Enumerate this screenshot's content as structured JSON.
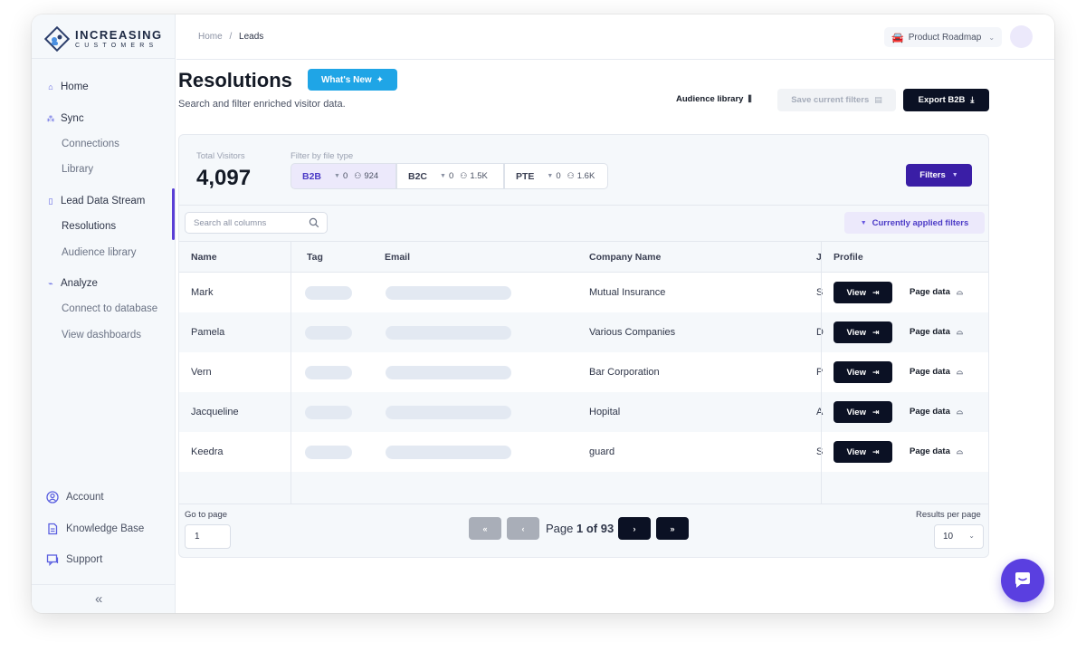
{
  "brand": {
    "name": "INCREASING",
    "tagline": "CUSTOMERS"
  },
  "sidebar": {
    "items": [
      {
        "label": "Home",
        "icon": "home-icon"
      },
      {
        "label": "Sync",
        "icon": "sync-icon"
      },
      {
        "label": "Connections"
      },
      {
        "label": "Library"
      },
      {
        "label": "Lead Data Stream",
        "icon": "document-icon"
      },
      {
        "label": "Resolutions",
        "active": true
      },
      {
        "label": "Audience library"
      },
      {
        "label": "Analyze",
        "icon": "analyze-icon"
      },
      {
        "label": "Connect to database"
      },
      {
        "label": "View dashboards"
      }
    ],
    "bottom": [
      {
        "label": "Account",
        "icon": "user-circle-icon"
      },
      {
        "label": "Knowledge Base",
        "icon": "book-icon"
      },
      {
        "label": "Support",
        "icon": "chat-bubble-icon"
      }
    ],
    "collapse_label": "«"
  },
  "header": {
    "breadcrumb": [
      "Home",
      "Leads"
    ],
    "breadcrumb_sep": "/",
    "project": "Product Roadmap"
  },
  "main": {
    "title": "Resolutions",
    "whats_new": "What's New",
    "subtitle": "Search and filter enriched visitor data.",
    "audience_library": "Audience library",
    "save_filters": "Save current filters",
    "export": "Export B2B"
  },
  "stats": {
    "total_label": "Total Visitors",
    "total_value": "4,097",
    "filter_label": "Filter by file type",
    "file_types": [
      {
        "name": "B2B",
        "filtered": "0",
        "count": "924",
        "selected": true
      },
      {
        "name": "B2C",
        "filtered": "0",
        "count": "1.5K"
      },
      {
        "name": "PTE",
        "filtered": "0",
        "count": "1.6K"
      }
    ],
    "filters_button": "Filters"
  },
  "table": {
    "search_placeholder": "Search all columns",
    "applied_filters": "Currently applied filters",
    "columns": [
      "Name",
      "Tag",
      "Email",
      "Company Name",
      "J",
      "Profile"
    ],
    "rows": [
      {
        "name": "Mark",
        "company": "Mutual Insurance",
        "j": "S"
      },
      {
        "name": "Pamela",
        "company": "Various Companies",
        "j": "D"
      },
      {
        "name": "Vern",
        "company": "Bar Corporation",
        "j": "P"
      },
      {
        "name": "Jacqueline",
        "company": "Hopital",
        "j": "A"
      },
      {
        "name": "Keedra",
        "company": "guard",
        "j": "S"
      }
    ],
    "view_label": "View",
    "page_data_label": "Page data"
  },
  "pagination": {
    "goto_label": "Go to page",
    "goto_value": "1",
    "page_prefix": "Page",
    "page_current": "1",
    "page_of": "of",
    "page_total": "93",
    "first": "«",
    "prev": "‹",
    "next": "›",
    "last": "»",
    "rpp_label": "Results per page",
    "rpp_value": "10"
  },
  "colors": {
    "accent": "#3a1ea6",
    "primary_dark": "#0b1124",
    "whats_new": "#1fa5e6",
    "chat": "#5a3fe0"
  }
}
